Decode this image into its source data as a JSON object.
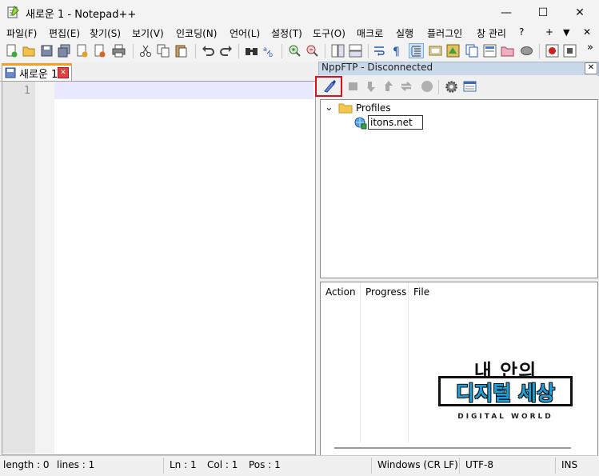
{
  "window": {
    "title": "새로운 1 - Notepad++",
    "minimize": "—",
    "maximize": "☐",
    "close": "✕"
  },
  "menu": [
    "파일(F)",
    "편집(E)",
    "찾기(S)",
    "보기(V)",
    "인코딩(N)",
    "언어(L)",
    "설정(T)",
    "도구(O)",
    "매크로",
    "실행",
    "플러그인",
    "창 관리",
    "?"
  ],
  "menu_right": {
    "plus": "+",
    "down": "▼",
    "close": "✕"
  },
  "toolbar_overflow": "»",
  "editor": {
    "tab_label": "새로운 1",
    "tab_close": "✕",
    "line_number": "1"
  },
  "ftp": {
    "title": "NppFTP - Disconnected",
    "close": "✕",
    "tree": {
      "expander": "⌄",
      "profiles_label": "Profiles",
      "profile_name": "itons.net"
    },
    "queue_columns": [
      "Action",
      "Progress",
      "File"
    ],
    "watermark": {
      "line1": "내 안의",
      "line2": "디지털 세상",
      "line3": "DIGITAL WORLD"
    }
  },
  "status": {
    "length": "length : 0",
    "lines": "lines : 1",
    "ln": "Ln : 1",
    "col": "Col : 1",
    "pos": "Pos : 1",
    "eol": "Windows (CR LF)",
    "encoding": "UTF-8",
    "mode": "INS"
  },
  "colors": {
    "accent_red": "#e0101a",
    "tab_accent": "#f0a030",
    "panel_header": "#c9d9ea",
    "current_line": "#e8e8ff"
  }
}
